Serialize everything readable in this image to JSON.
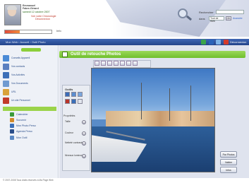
{
  "user": {
    "name_line1": "Emmanuel",
    "name_line2": "Fabre-Gérard",
    "date": "samedi 12 octobre 2007",
    "link1": "Voir votre Chronologie",
    "link2": "Déconnexion",
    "progress_percent": 32,
    "progress_label": "Info"
  },
  "search": {
    "label": "Rechercher",
    "value": "",
    "dans_label": "dans",
    "dans_value": "Tout de Web",
    "ok_label": "OK",
    "advanced_label": "Avancée"
  },
  "nav": {
    "breadcrumb": "Mon Web › Accueil › Outil Photo",
    "quit_label": "Déconnexion",
    "icons": [
      "arrow-icon",
      "home-icon",
      "help-icon",
      "close-icon"
    ],
    "icon_colors": [
      "#3aa34a",
      "#2a63b8",
      "#7db3e8",
      "#d43a2a"
    ]
  },
  "sidebar": {
    "items": [
      {
        "label": "Conseils Appareil",
        "icon": "conseils-icon",
        "color": "#4a8ad6"
      },
      {
        "label": "Vos contacts",
        "icon": "contacts-icon",
        "color": "#5a7fc0"
      },
      {
        "label": "Vos Activités",
        "icon": "activites-icon",
        "color": "#3c6fb8"
      },
      {
        "label": "Vos Documents",
        "icon": "documents-icon",
        "color": "#6f9ad0"
      },
      {
        "label": "URL",
        "icon": "url-icon",
        "color": "#d9a23a"
      },
      {
        "label": "Un site Personnel",
        "icon": "site-icon",
        "color": "#c23a2a"
      }
    ],
    "sub_items": [
      {
        "label": "Calendrier",
        "icon": "calendar-icon",
        "color": "#3a9a3a"
      },
      {
        "label": "Souvenir",
        "icon": "souvenir-icon",
        "color": "#d18a2a"
      },
      {
        "label": "Mon Photo Perso",
        "icon": "photo-icon",
        "color": "#3a6fb8"
      },
      {
        "label": "Agenda Perso",
        "icon": "agenda-icon",
        "color": "#2a4d8a"
      },
      {
        "label": "Mon Outil",
        "icon": "outil-icon",
        "color": "#5a88c4"
      }
    ]
  },
  "panel": {
    "title": "Outil de retouche Photos",
    "tools_title": "Outils",
    "props_title": "Propriétés",
    "props": [
      "Taille",
      "Couleur",
      "Netteté contraste",
      "Niveaux luminosité"
    ]
  },
  "actions": {
    "save": "Par Photos",
    "restore": "Valider",
    "cancel": "Infos"
  },
  "footer": "© 2007-2008 Tous droits réservés à Ma Page Web"
}
